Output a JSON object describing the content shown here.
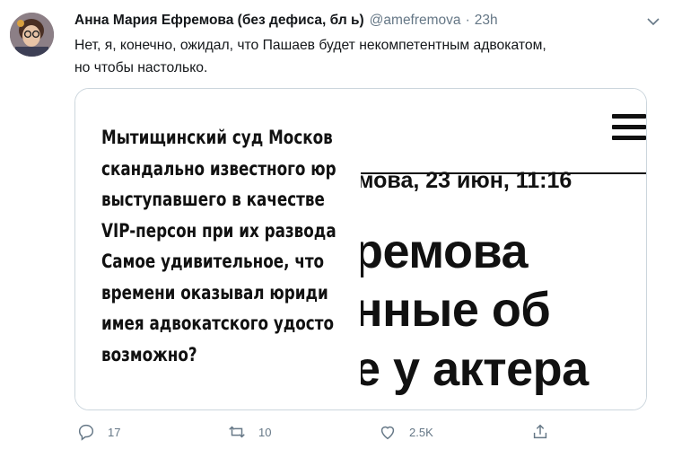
{
  "tweet": {
    "author_name": "Анна Мария Ефремова (без дефиса, бл   ь)",
    "handle": "@amefremova",
    "separator": "·",
    "timestamp": "23h",
    "text_line1": "Нет, я, конечно, ожидал, что Пашаев будет некомпетентным адвокатом,",
    "text_line2": "но чтобы настолько."
  },
  "media": {
    "left_lines": [
      "Мытищинский суд Москов",
      "скандально известного юр",
      "выступавшего в качестве",
      "VIP-персон при их развода",
      "Самое удивительное, что",
      "времени оказывал юриди",
      "имея адвокатского удосто",
      "возможно?"
    ],
    "byline": "мова, 23 июн, 11:16",
    "headline": [
      "ремова",
      "нные об",
      "е у актера"
    ]
  },
  "actions": {
    "reply_count": "17",
    "retweet_count": "10",
    "like_count": "2.5K"
  },
  "icons": [
    "avatar",
    "chevron-down-icon",
    "menu-icon",
    "reply-icon",
    "retweet-icon",
    "like-icon",
    "share-icon"
  ]
}
